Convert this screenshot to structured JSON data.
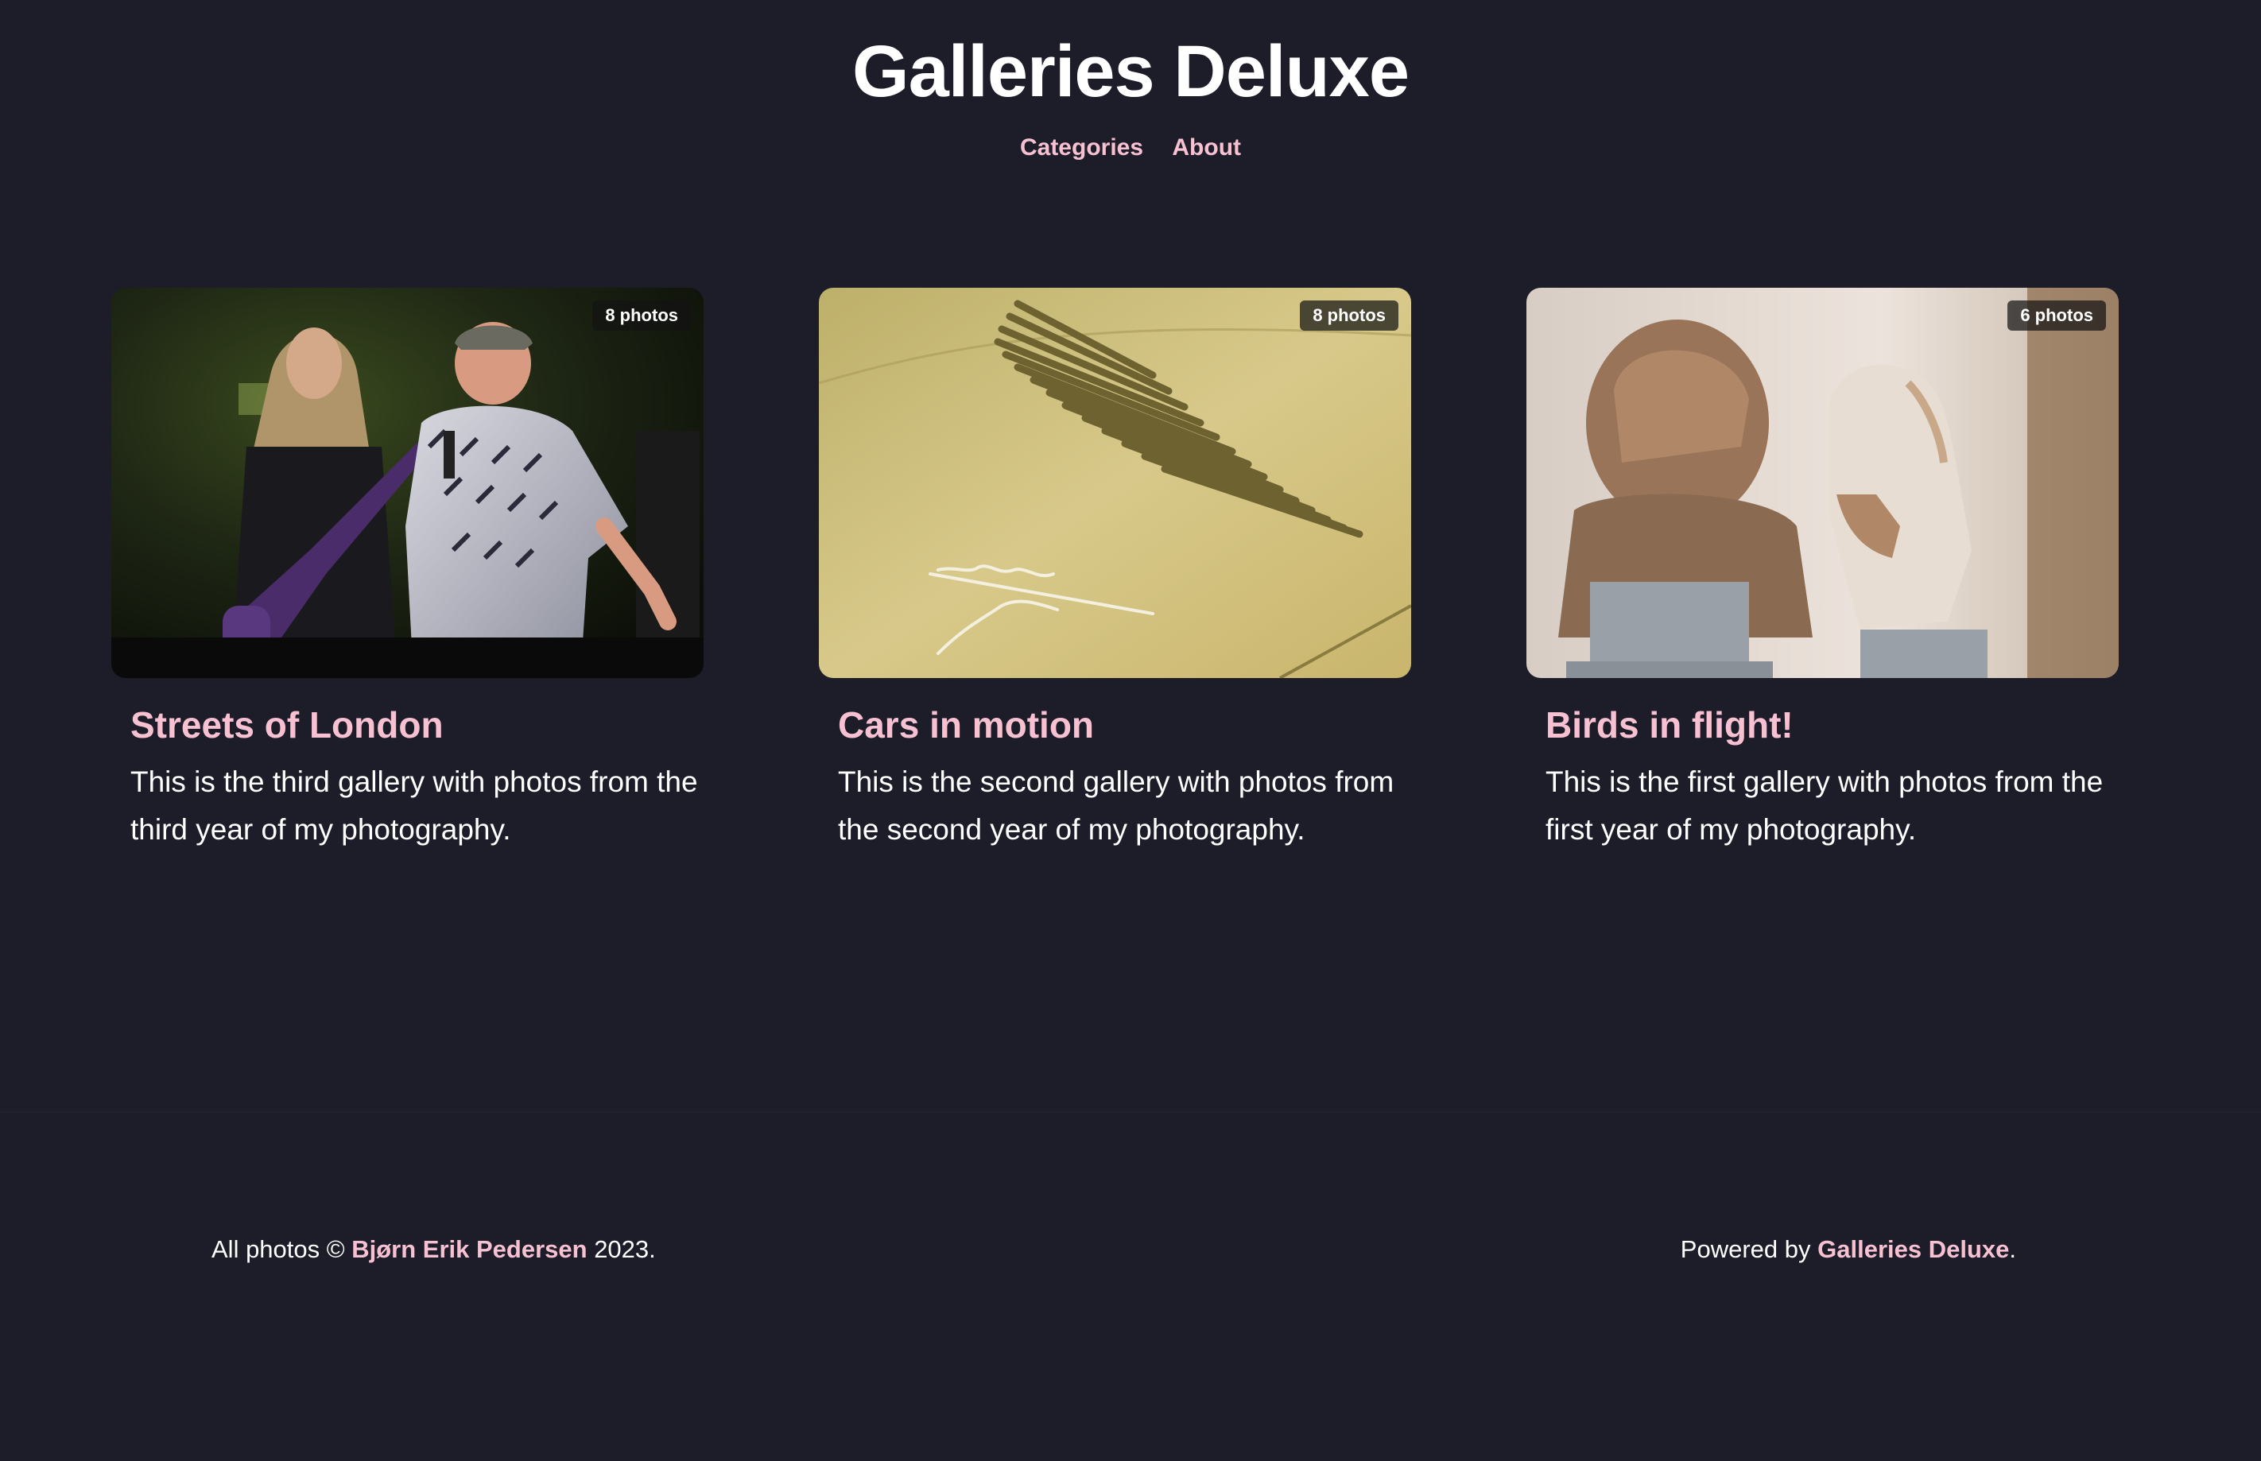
{
  "site": {
    "title": "Galleries Deluxe"
  },
  "nav": {
    "items": [
      {
        "label": "Categories"
      },
      {
        "label": "About"
      }
    ]
  },
  "galleries": [
    {
      "title": "Streets of London",
      "photo_count": "8 photos",
      "description": "This is the third gallery with photos from the third year of my photography."
    },
    {
      "title": "Cars in motion",
      "photo_count": "8 photos",
      "description": "This is the second gallery with photos from the second year of my photography."
    },
    {
      "title": "Birds in flight!",
      "photo_count": "6 photos",
      "description": "This is the first gallery with photos from the first year of my photography."
    }
  ],
  "footer": {
    "copyright_prefix": "All photos ©",
    "author": "Bjørn Erik Pedersen",
    "copyright_suffix": "2023.",
    "powered_prefix": "Powered by",
    "powered_link": "Galleries Deluxe",
    "powered_suffix": "."
  },
  "colors": {
    "background": "#1d1d2a",
    "accent": "#f7c1d1",
    "text": "#ffffff"
  }
}
